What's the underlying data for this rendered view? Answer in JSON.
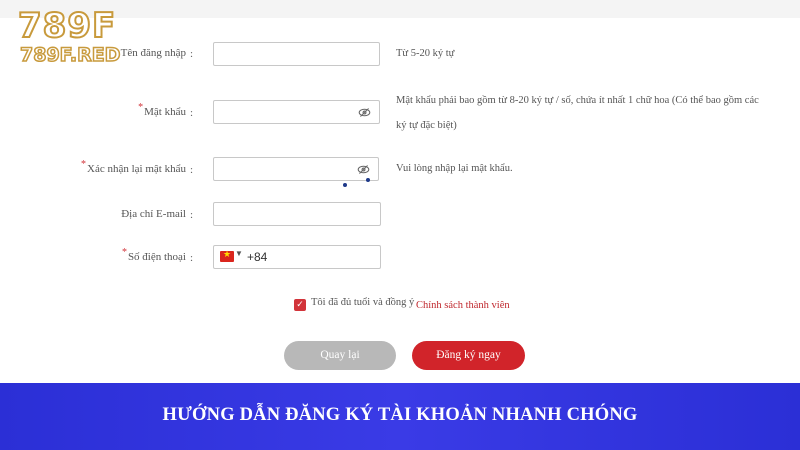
{
  "logo": {
    "main": "789F",
    "sub": "789F.RED"
  },
  "form": {
    "username": {
      "label": "Tên đăng nhập",
      "colon": ":",
      "hint": "Từ 5-20 ký tự"
    },
    "password": {
      "label": "Mật khẩu",
      "colon": ":",
      "hint_line1": "Mật khẩu phải bao gồm từ 8-20 ký tự / số, chứa ít nhất 1 chữ hoa (Có thể bao gồm các",
      "hint_line2": "ký tự đặc biệt)"
    },
    "confirm": {
      "label": "Xác nhận lại mật khẩu",
      "colon": ":",
      "hint": "Vui lòng nhập lại mật khẩu."
    },
    "email": {
      "label": "Địa chỉ E-mail",
      "colon": ":"
    },
    "phone": {
      "label": "Số điện thoại",
      "colon": ":",
      "prefix": "+84"
    },
    "required_mark": "*",
    "agree": {
      "text": "Tôi đã đủ tuổi và đồng ý",
      "link": "Chính sách thành viên"
    },
    "buttons": {
      "back": "Quay lại",
      "register": "Đăng ký ngay"
    }
  },
  "banner": {
    "title": "HƯỚNG DẪN ĐĂNG KÝ TÀI KHOẢN NHANH CHÓNG"
  },
  "colors": {
    "accent": "#d1242a",
    "banner": "#3a3be6",
    "logo_gold": "#c89a3c",
    "muted_button": "#b8b8b8"
  },
  "icons": [
    "eye-slash-icon",
    "vietnam-flag-icon",
    "chevron-down-icon",
    "check-icon"
  ]
}
